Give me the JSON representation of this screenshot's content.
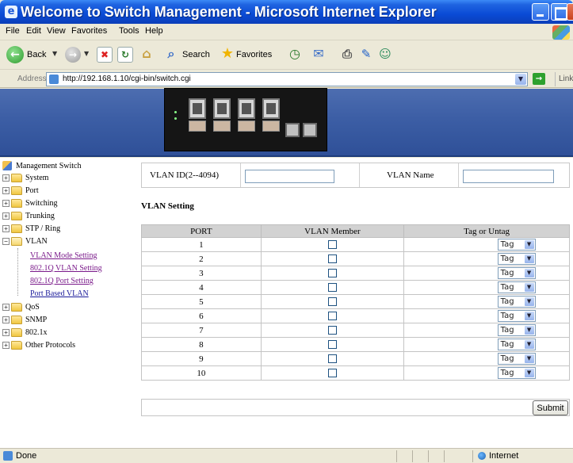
{
  "window": {
    "title": "Welcome to Switch Management - Microsoft Internet Explorer"
  },
  "menu": [
    "File",
    "Edit",
    "View",
    "Favorites",
    "Tools",
    "Help"
  ],
  "toolbar": {
    "back_label": "Back",
    "search_label": "Search",
    "favorites_label": "Favorites"
  },
  "address": {
    "label": "Address",
    "url": "http://192.168.1.10/cgi-bin/switch.cgi",
    "go_label": "Go",
    "links_label": "Links"
  },
  "tree": {
    "root": "Management Switch",
    "items": [
      {
        "label": "System"
      },
      {
        "label": "Port"
      },
      {
        "label": "Switching"
      },
      {
        "label": "Trunking"
      },
      {
        "label": "STP / Ring"
      },
      {
        "label": "VLAN"
      },
      {
        "label": "VLAN Mode Setting"
      },
      {
        "label": "802.1Q VLAN Setting"
      },
      {
        "label": "802.1Q Port Setting"
      },
      {
        "label": "Port Based VLAN"
      },
      {
        "label": "QoS"
      },
      {
        "label": "SNMP"
      },
      {
        "label": "802.1x"
      },
      {
        "label": "Other Protocols"
      }
    ]
  },
  "form": {
    "vlan_id_label": "VLAN ID(2--4094)",
    "vlan_id_value": "",
    "vlan_name_label": "VLAN Name",
    "vlan_name_value": "",
    "section_title": "VLAN Setting",
    "headers": [
      "PORT",
      "VLAN Member",
      "Tag or Untag"
    ],
    "rows": [
      {
        "port": "1",
        "member": false,
        "tag": "Tag"
      },
      {
        "port": "2",
        "member": false,
        "tag": "Tag"
      },
      {
        "port": "3",
        "member": false,
        "tag": "Tag"
      },
      {
        "port": "4",
        "member": false,
        "tag": "Tag"
      },
      {
        "port": "5",
        "member": false,
        "tag": "Tag"
      },
      {
        "port": "6",
        "member": false,
        "tag": "Tag"
      },
      {
        "port": "7",
        "member": false,
        "tag": "Tag"
      },
      {
        "port": "8",
        "member": false,
        "tag": "Tag"
      },
      {
        "port": "9",
        "member": false,
        "tag": "Tag"
      },
      {
        "port": "10",
        "member": false,
        "tag": "Tag"
      }
    ],
    "submit_label": "Submit"
  },
  "status": {
    "text": "Done",
    "zone": "Internet"
  },
  "colors": {
    "titlebar": "#0a4bd6",
    "banner": "#3c5ea5",
    "table_header": "#d2d2d2",
    "link": "#1a1a9a",
    "link_visited": "#7a1a8a"
  }
}
